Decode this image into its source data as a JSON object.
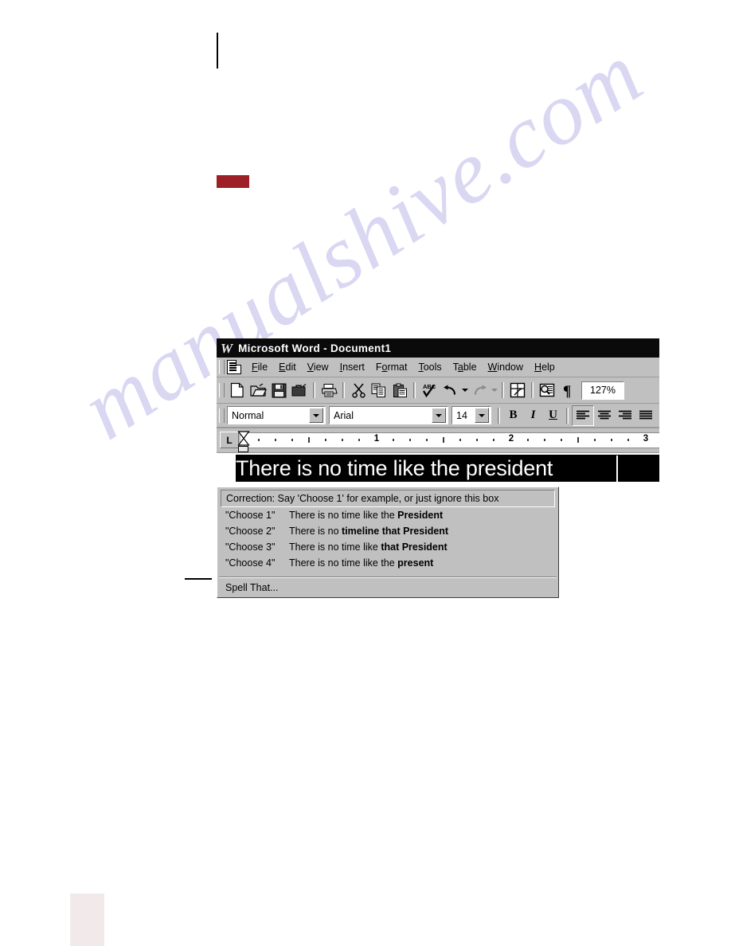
{
  "page": {
    "watermark_text": "manualshive.com"
  },
  "window": {
    "app_icon": "word-w-logo",
    "title": "Microsoft Word - Document1"
  },
  "menu": {
    "doc_icon": "document-icon",
    "items": [
      {
        "label": "File",
        "mnemonic": "F"
      },
      {
        "label": "Edit",
        "mnemonic": "E"
      },
      {
        "label": "View",
        "mnemonic": "V"
      },
      {
        "label": "Insert",
        "mnemonic": "I"
      },
      {
        "label": "Format",
        "mnemonic": "o"
      },
      {
        "label": "Tools",
        "mnemonic": "T"
      },
      {
        "label": "Table",
        "mnemonic": "a"
      },
      {
        "label": "Window",
        "mnemonic": "W"
      },
      {
        "label": "Help",
        "mnemonic": "H"
      }
    ]
  },
  "standard_toolbar": {
    "buttons": [
      {
        "name": "new-document",
        "icon": "new-page-icon"
      },
      {
        "name": "open",
        "icon": "open-folder-icon"
      },
      {
        "name": "save",
        "icon": "floppy-disk-icon"
      },
      {
        "name": "mail",
        "icon": "briefcase-icon"
      },
      {
        "name": "print",
        "icon": "printer-icon"
      },
      {
        "name": "cut",
        "icon": "scissors-icon"
      },
      {
        "name": "copy",
        "icon": "copy-icon"
      },
      {
        "name": "paste",
        "icon": "clipboard-icon"
      },
      {
        "name": "spelling",
        "icon": "abc-check-icon"
      },
      {
        "name": "undo",
        "icon": "undo-arrow-icon"
      },
      {
        "name": "redo",
        "icon": "redo-arrow-icon"
      },
      {
        "name": "insert-table",
        "icon": "table-grid-icon"
      },
      {
        "name": "print-preview",
        "icon": "magnifier-page-icon"
      },
      {
        "name": "show-marks",
        "icon": "pilcrow-icon"
      }
    ],
    "zoom_value": "127%"
  },
  "formatting_toolbar": {
    "style": "Normal",
    "font": "Arial",
    "size": "14",
    "bold_label": "B",
    "italic_label": "I",
    "underline_label": "U",
    "align_buttons": [
      {
        "name": "align-left",
        "state": "pressed"
      },
      {
        "name": "align-center",
        "state": "normal"
      },
      {
        "name": "align-right",
        "state": "normal"
      },
      {
        "name": "align-justify",
        "state": "normal"
      }
    ]
  },
  "ruler": {
    "tab_selector_label": "L",
    "numbers": [
      "1",
      "2",
      "3"
    ]
  },
  "document": {
    "selected_text": "There is no time like the president"
  },
  "correction_panel": {
    "header": "Correction: Say 'Choose 1' for example, or just ignore this box",
    "choices": [
      {
        "command": "\"Choose 1\"",
        "prefix": "There is no time like the ",
        "bold": "President"
      },
      {
        "command": "\"Choose 2\"",
        "prefix": "There is no ",
        "bold": "timeline that President"
      },
      {
        "command": "\"Choose 3\"",
        "prefix": "There is no time like ",
        "bold": "that President"
      },
      {
        "command": "\"Choose 4\"",
        "prefix": "There is no time like the ",
        "bold": "present"
      }
    ],
    "footer": "Spell That..."
  }
}
